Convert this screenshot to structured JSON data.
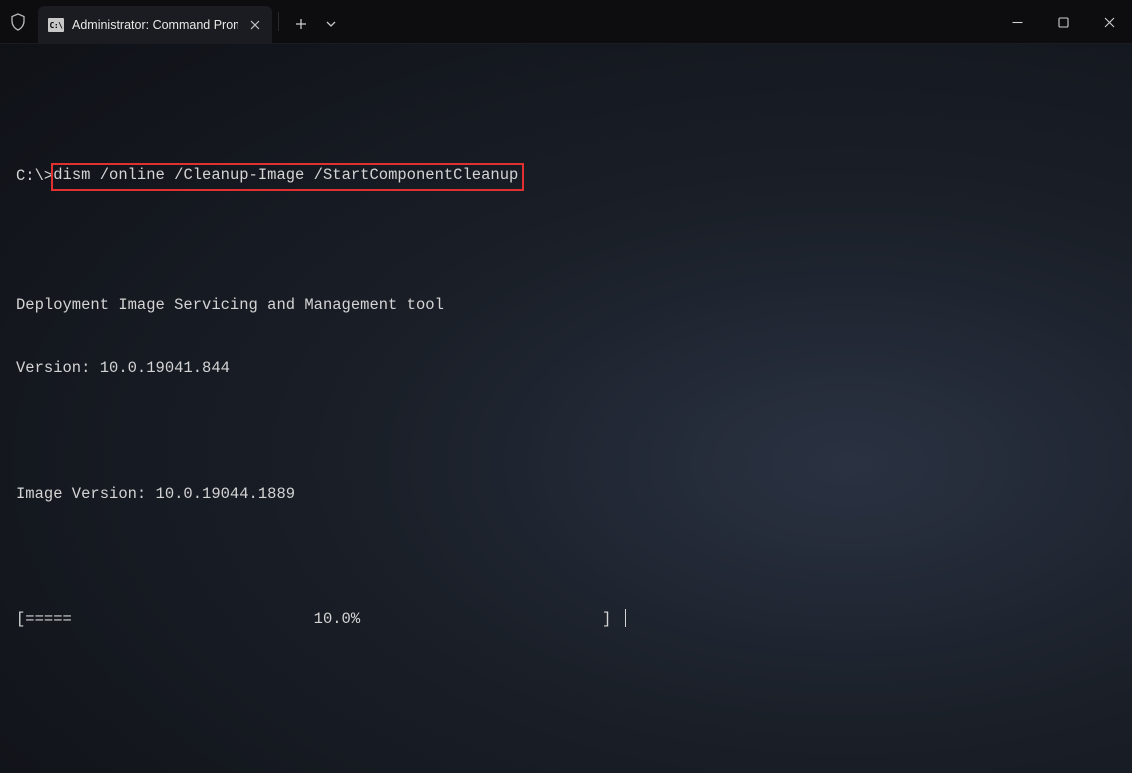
{
  "tab": {
    "title": "Administrator: Command Prom",
    "icon_text": "C:\\"
  },
  "terminal": {
    "prompt": "C:\\>",
    "command": "dism /online /Cleanup-Image /StartComponentCleanup",
    "line1": "Deployment Image Servicing and Management tool",
    "line2": "Version: 10.0.19041.844",
    "line3": "Image Version: 10.0.19044.1889",
    "progress": "[=====                          10.0%                          ] "
  }
}
